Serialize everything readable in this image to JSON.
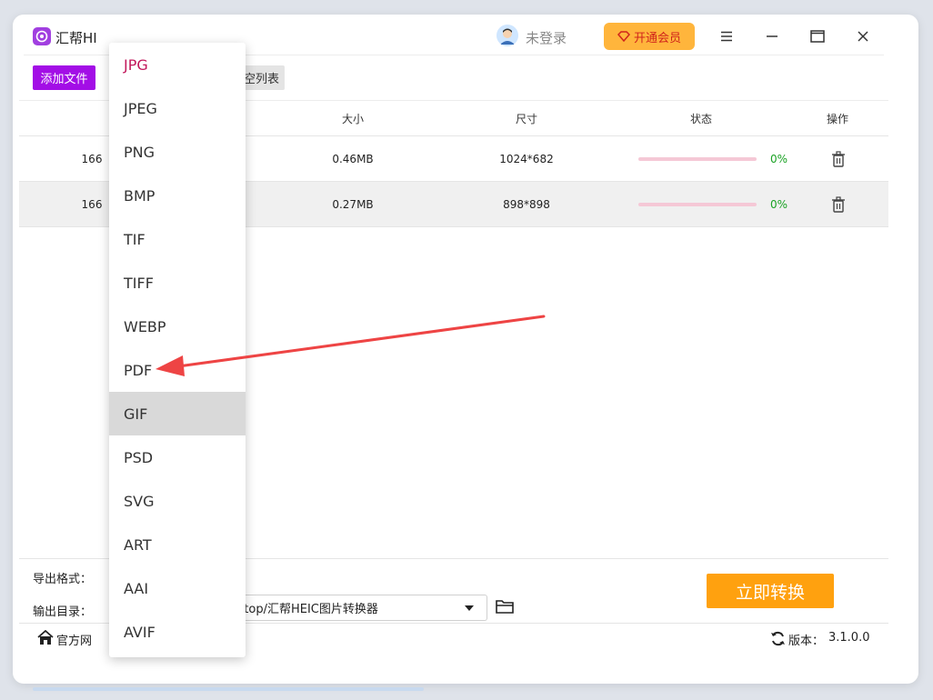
{
  "app": {
    "title": "汇帮HI",
    "login_text": "未登录",
    "vip_label": "开通会员"
  },
  "toolbar": {
    "add_file": "添加文件",
    "clear_list": "清空列表"
  },
  "table": {
    "headers": {
      "size": "大小",
      "dimensions": "尺寸",
      "status": "状态",
      "action": "操作"
    },
    "rows": [
      {
        "name": "166",
        "size": "0.46MB",
        "dimensions": "1024*682",
        "progress": "0%",
        "progress_value": 0
      },
      {
        "name": "166",
        "size": "0.27MB",
        "dimensions": "898*898",
        "progress": "0%",
        "progress_value": 0
      }
    ]
  },
  "bottom": {
    "format_label": "导出格式：",
    "dir_label": "输出目录：",
    "dir_value": "esktop/汇帮HEIC图片转换器",
    "convert_label": "立即转换"
  },
  "footer": {
    "site_link": "官方网",
    "version_label": "版本：",
    "version_value": "3.1.0.0"
  },
  "dropdown": {
    "items": [
      "JPG",
      "JPEG",
      "PNG",
      "BMP",
      "TIF",
      "TIFF",
      "WEBP",
      "PDF",
      "GIF",
      "PSD",
      "SVG",
      "ART",
      "AAI",
      "AVIF"
    ],
    "selected": "JPG",
    "hovered": "GIF"
  },
  "annotation": {
    "arrow_target": "PDF",
    "arrow_color": "#ee4444"
  },
  "colors": {
    "accent_purple": "#a30ee6",
    "convert_orange": "#ffa10f",
    "vip_yellow": "#ffb53c",
    "progress_green": "#1aa224",
    "selected_pink": "#c2185b"
  }
}
